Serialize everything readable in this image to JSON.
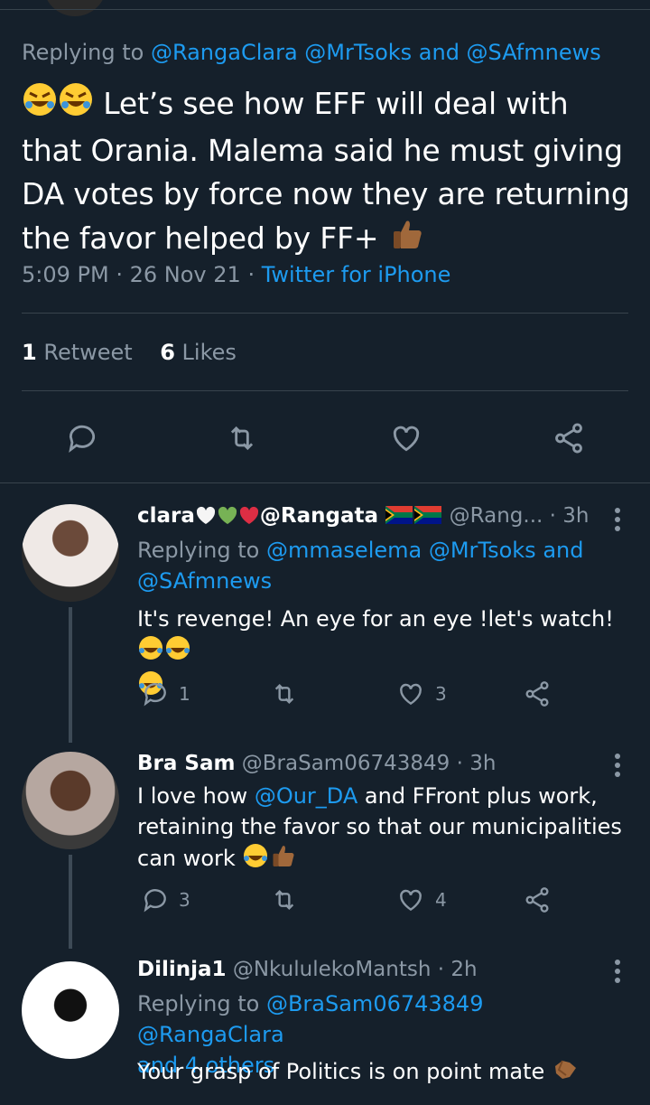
{
  "main_tweet": {
    "replying_prefix": "Replying to",
    "replying_to": "@RangaClara @MrTsoks and @SAfmnews",
    "text_line1": "Let’s see how EFF will deal with",
    "text_rest": "that Orania. Malema said he must giving DA votes by force now they are returning the favor helped by FF+",
    "time": "5:09 PM",
    "date": "26 Nov 21",
    "source": "Twitter for iPhone",
    "retweets_count": "1",
    "retweets_label": "Retweet",
    "likes_count": "6",
    "likes_label": "Likes",
    "emoji_lead": "rolling-on-floor-laughing x2",
    "emoji_end": "thumbs-up"
  },
  "replies": [
    {
      "name": "clara",
      "name_suffix": "@Rangata",
      "handle": "@Rang...",
      "time": "· 3h",
      "replying_prefix": "Replying to",
      "replying_to": "@mmaselema @MrTsoks and",
      "replying_to_2": "@SAfmnews",
      "text": "It's revenge! An eye for an eye !let's watch!",
      "reply_count": "1",
      "retweet_count": "",
      "like_count": "3"
    },
    {
      "name": "Bra Sam",
      "handle": "@BraSam06743849",
      "time": "· 3h",
      "text_prefix": "I love how",
      "mention": "@Our_DA",
      "text_rest": "and FFront plus work, retaining the favor so that our municipalities can work",
      "reply_count": "3",
      "retweet_count": "",
      "like_count": "4"
    },
    {
      "name": "Dilinja1",
      "handle": "@NkululekoMantsh",
      "time": "· 2h",
      "replying_prefix": "Replying to",
      "replying_to": "@BraSam06743849 @RangaClara",
      "replying_to_2": "and 4 others",
      "text": "Your grasp of Politics is on point mate"
    }
  ],
  "colors": {
    "background": "#15202b",
    "accent": "#1d9bf0",
    "muted": "#8b98a5",
    "divider": "#38444d"
  }
}
